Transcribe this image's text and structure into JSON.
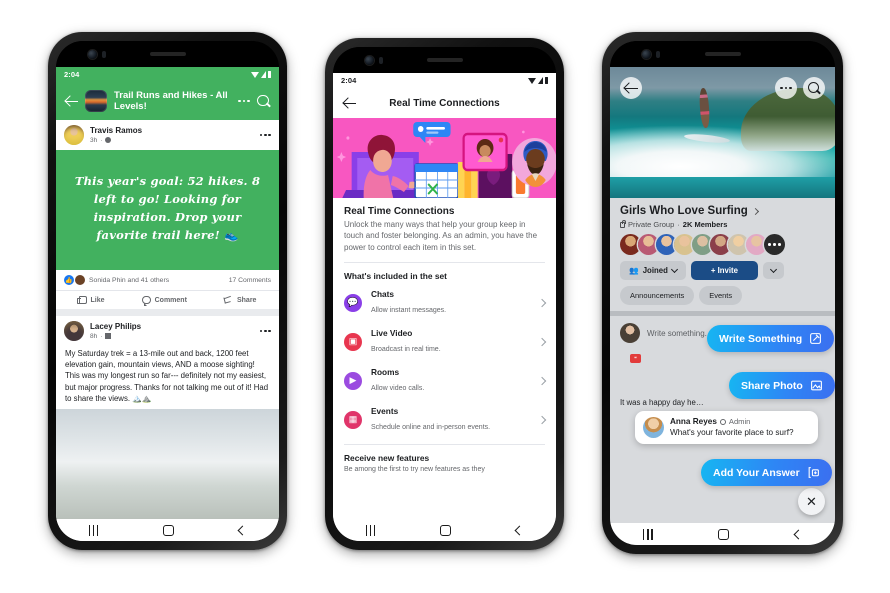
{
  "phones": [
    {
      "id": "phone-1",
      "status": {
        "time": "2:04",
        "icons": [
          "wifi-icon",
          "signal-icon",
          "battery-icon"
        ]
      },
      "header": {
        "back_icon": "arrow-left-icon",
        "group_thumb": "group-thumbnail",
        "title": "Trail Runs and Hikes - All Levels!",
        "more_icon": "more-horizontal-icon",
        "search_icon": "search-icon"
      },
      "posts": [
        {
          "author": "Travis Ramos",
          "time": "3h",
          "audience_icon": "globe-icon",
          "more_icon": "more-horizontal-icon",
          "background_text": "This year's goal: 52 hikes. 8 left to go! Looking for inspiration. Drop your favorite trail here! 👟",
          "background_color": "#42B15F",
          "reactions_text": "Sonida Phin and 41 others",
          "comments_text": "17 Comments",
          "actions": [
            "Like",
            "Comment",
            "Share"
          ]
        },
        {
          "author": "Lacey Philips",
          "time": "8h",
          "audience_icon": "group-icon",
          "more_icon": "more-horizontal-icon",
          "body": "My Saturday trek = a 13-mile out and back, 1200 feet elevation gain, mountain views, AND a moose sighting! This was my longest run so far--- definitely not my easiest, but major progress. Thanks for not talking me out of it! Had to share the views. 🏔️⛰️"
        }
      ],
      "navbar": [
        "recents-icon",
        "home-icon",
        "back-icon"
      ]
    },
    {
      "id": "phone-2",
      "status": {
        "time": "2:04",
        "icons": [
          "wifi-icon",
          "signal-icon",
          "battery-icon"
        ]
      },
      "header": {
        "back_icon": "arrow-left-icon",
        "title": "Real Time Connections"
      },
      "hero": {
        "name": "real-time-connections-illustration",
        "bg_color": "#F857C1"
      },
      "section": {
        "title": "Real Time Connections",
        "description": "Unlock the many ways that help your group keep in touch and foster belonging. As an admin, you have the power to control each item in this set.",
        "included_label": "What's included in the set"
      },
      "items": [
        {
          "title": "Chats",
          "subtitle": "Allow instant messages.",
          "icon": "chat-bubble-icon",
          "color": "#8A3FE8"
        },
        {
          "title": "Live Video",
          "subtitle": "Broadcast in real time.",
          "icon": "live-video-icon",
          "color": "#E8364F"
        },
        {
          "title": "Rooms",
          "subtitle": "Allow video calls.",
          "icon": "video-room-icon",
          "color": "#9B4BE0"
        },
        {
          "title": "Events",
          "subtitle": "Schedule online and in-person events.",
          "icon": "calendar-icon",
          "color": "#E0356A"
        }
      ],
      "footer": {
        "title": "Receive new features",
        "subtitle": "Be among the first to try new features as they"
      },
      "navbar": [
        "recents-icon",
        "home-icon",
        "back-icon"
      ]
    },
    {
      "id": "phone-3",
      "cover": {
        "name": "surfing-cover-photo"
      },
      "cover_buttons": {
        "back_icon": "arrow-left-icon",
        "more_icon": "more-horizontal-icon",
        "search_icon": "search-icon"
      },
      "group": {
        "name": "Girls Who Love Surfing",
        "chevron_icon": "chevron-right-icon",
        "privacy_icon": "lock-icon",
        "privacy": "Private Group",
        "separator": "·",
        "members": "2K Members"
      },
      "buttons": {
        "joined": "Joined",
        "joined_icon": "people-icon",
        "joined_caret": "chevron-down-icon",
        "invite": "+ Invite",
        "overflow_caret": "chevron-down-icon"
      },
      "tabs": [
        "Announcements",
        "Events"
      ],
      "composer": {
        "placeholder": "Write something...",
        "avatar": "user-avatar"
      },
      "feed_text": "It was a happy day he…",
      "floating_buttons": [
        {
          "label": "Write Something",
          "icon": "compose-icon"
        },
        {
          "label": "Share Photo",
          "icon": "photo-icon"
        },
        {
          "label": "Add Your Answer",
          "icon": "add-answer-icon"
        }
      ],
      "question_card": {
        "author": "Anna Reyes",
        "badge_icon": "admin-shield-icon",
        "badge": "Admin",
        "question": "What's your favorite place to surf?"
      },
      "close_button": {
        "icon": "close-icon",
        "label": "✕"
      },
      "navbar": [
        "recents-icon",
        "home-icon",
        "back-icon"
      ]
    }
  ]
}
